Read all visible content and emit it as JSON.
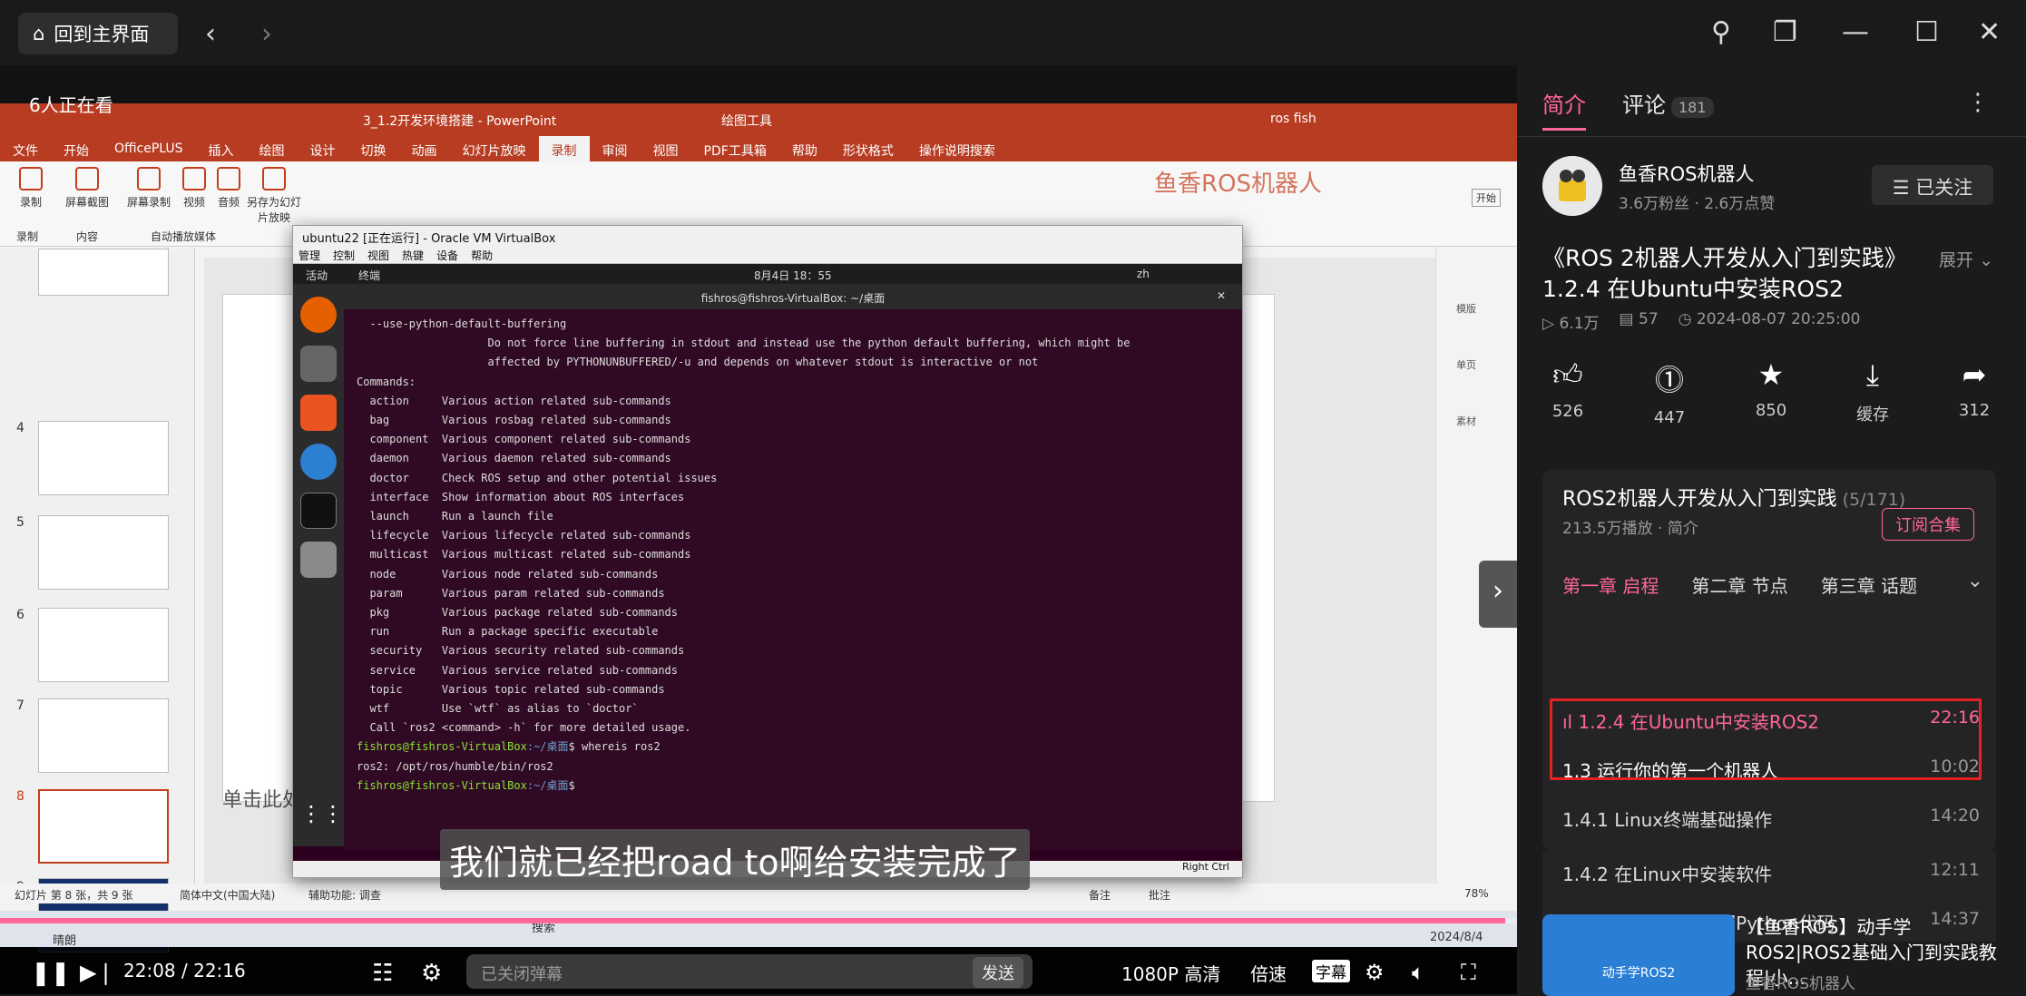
{
  "topbar": {
    "home_label": "回到主界面"
  },
  "video": {
    "viewers": "6人正在看",
    "ppt": {
      "title": "3_1.2开发环境搭建 - PowerPoint",
      "drawing_tools": "绘图工具",
      "user": "ros fish",
      "tabs": [
        "文件",
        "开始",
        "OfficePLUS",
        "插入",
        "绘图",
        "设计",
        "切换",
        "动画",
        "幻灯片放映",
        "录制",
        "审阅",
        "视图",
        "PDF工具箱",
        "帮助",
        "形状格式",
        "操作说明搜索"
      ],
      "active_tab": "录制",
      "ribbon": [
        {
          "label": "录制"
        },
        {
          "label": "屏幕截图"
        },
        {
          "label": "屏幕录制"
        },
        {
          "label": "视频"
        },
        {
          "label": "音频"
        },
        {
          "label": "另存为幻灯片放映"
        }
      ],
      "ribbon_groups": [
        "录制",
        "内容",
        "自动播放媒体"
      ],
      "watermark": "鱼香ROS机器人",
      "slide_numbers": [
        "4",
        "5",
        "6",
        "7",
        "8",
        "9"
      ],
      "notes_placeholder": "单击此处添加备注",
      "status_left": "幻灯片 第 8 张，共 9 张",
      "status_lang": "简体中文(中国大陆)",
      "status_access": "辅助功能: 调查",
      "status_notes": "备注",
      "status_comments": "批注",
      "zoom": "78%",
      "right_panel": [
        "模版",
        "单页",
        "素材"
      ],
      "start_btn": "开始"
    },
    "vbox": {
      "title": "ubuntu22 [正在运行] - Oracle VM VirtualBox",
      "menu": [
        "管理",
        "控制",
        "视图",
        "热键",
        "设备",
        "帮助"
      ],
      "activities": "活动",
      "terminal_app": "终端",
      "clock": "8月4日 18：55",
      "lang": "zh",
      "term_title": "fishros@fishros-VirtualBox: ~/桌面",
      "lines": [
        "  --use-python-default-buffering",
        "                    Do not force line buffering in stdout and instead use the python default buffering, which might be",
        "                    affected by PYTHONUNBUFFERED/-u and depends on whatever stdout is interactive or not",
        "",
        "Commands:",
        "  action     Various action related sub-commands",
        "  bag        Various rosbag related sub-commands",
        "  component  Various component related sub-commands",
        "  daemon     Various daemon related sub-commands",
        "  doctor     Check ROS setup and other potential issues",
        "  interface  Show information about ROS interfaces",
        "  launch     Run a launch file",
        "  lifecycle  Various lifecycle related sub-commands",
        "  multicast  Various multicast related sub-commands",
        "  node       Various node related sub-commands",
        "  param      Various param related sub-commands",
        "  pkg        Various package related sub-commands",
        "  run        Run a package specific executable",
        "  security   Various security related sub-commands",
        "  service    Various service related sub-commands",
        "  topic      Various topic related sub-commands",
        "  wtf        Use `wtf` as alias to `doctor`",
        "",
        "  Call `ros2 <command> -h` for more detailed usage."
      ],
      "prompt_user": "fishros@fishros-VirtualBox",
      "prompt_path": ":~/桌面",
      "cmd1": "$ whereis ros2",
      "out1": "ros2: /opt/ros/humble/bin/ros2",
      "cmd2": "$ ",
      "status": "Right Ctrl"
    },
    "subtitle": "我们就已经把road to啊给安装完成了",
    "taskbar": {
      "weather": "晴朗",
      "search": "搜索",
      "date": "2024/8/4"
    },
    "progress": 0.992,
    "time": "22:08 / 22:16",
    "danmaku_placeholder": "已关闭弹幕",
    "send": "发送",
    "quality": "1080P 高清",
    "speed": "倍速",
    "cc": "字幕"
  },
  "panel": {
    "tab_intro": "简介",
    "tab_comments": "评论",
    "comment_count": "181",
    "up_name": "鱼香ROS机器人",
    "up_stats": "3.6万粉丝 · 2.6万点赞",
    "follow": "☰ 已关注",
    "video_title": "《ROS 2机器人开发从入门到实践》1.2.4 在Ubuntu中安装ROS2",
    "expand": "展开",
    "plays": "6.1万",
    "danmaku": "57",
    "date": "2024-08-07 20:25:00",
    "actions": [
      {
        "icon": "like-icon",
        "value": "526"
      },
      {
        "icon": "coin-icon",
        "value": "447"
      },
      {
        "icon": "star-icon",
        "value": "850"
      },
      {
        "icon": "cache-icon",
        "value": "缓存"
      },
      {
        "icon": "share-icon",
        "value": "312"
      }
    ],
    "collection": {
      "title": "ROS2机器人开发从入门到实践",
      "count": "(5/171)",
      "sub": "213.5万播放 · 简介",
      "subscribe": "订阅合集",
      "chapters": [
        "第一章 启程",
        "第二章 节点",
        "第三章 话题"
      ],
      "episodes": [
        {
          "title": "1.2.4 在Ubuntu中安装ROS2",
          "dur": "22:16"
        },
        {
          "title": "1.3 运行你的第一个机器人",
          "dur": "10:02"
        },
        {
          "title": "1.4.1 Linux终端基础操作",
          "dur": "14:20"
        },
        {
          "title": "1.4.2 在Linux中安装软件",
          "dur": "12:11"
        },
        {
          "title": "1.4.3 在Linux中编写Python代码",
          "dur": "14:37"
        }
      ]
    },
    "rec": {
      "thumb_text": "动手学ROS2",
      "title": "【鱼香ROS】动手学ROS2|ROS2基础入门到实践教程|小...",
      "up": "鱼香ROS机器人"
    }
  }
}
